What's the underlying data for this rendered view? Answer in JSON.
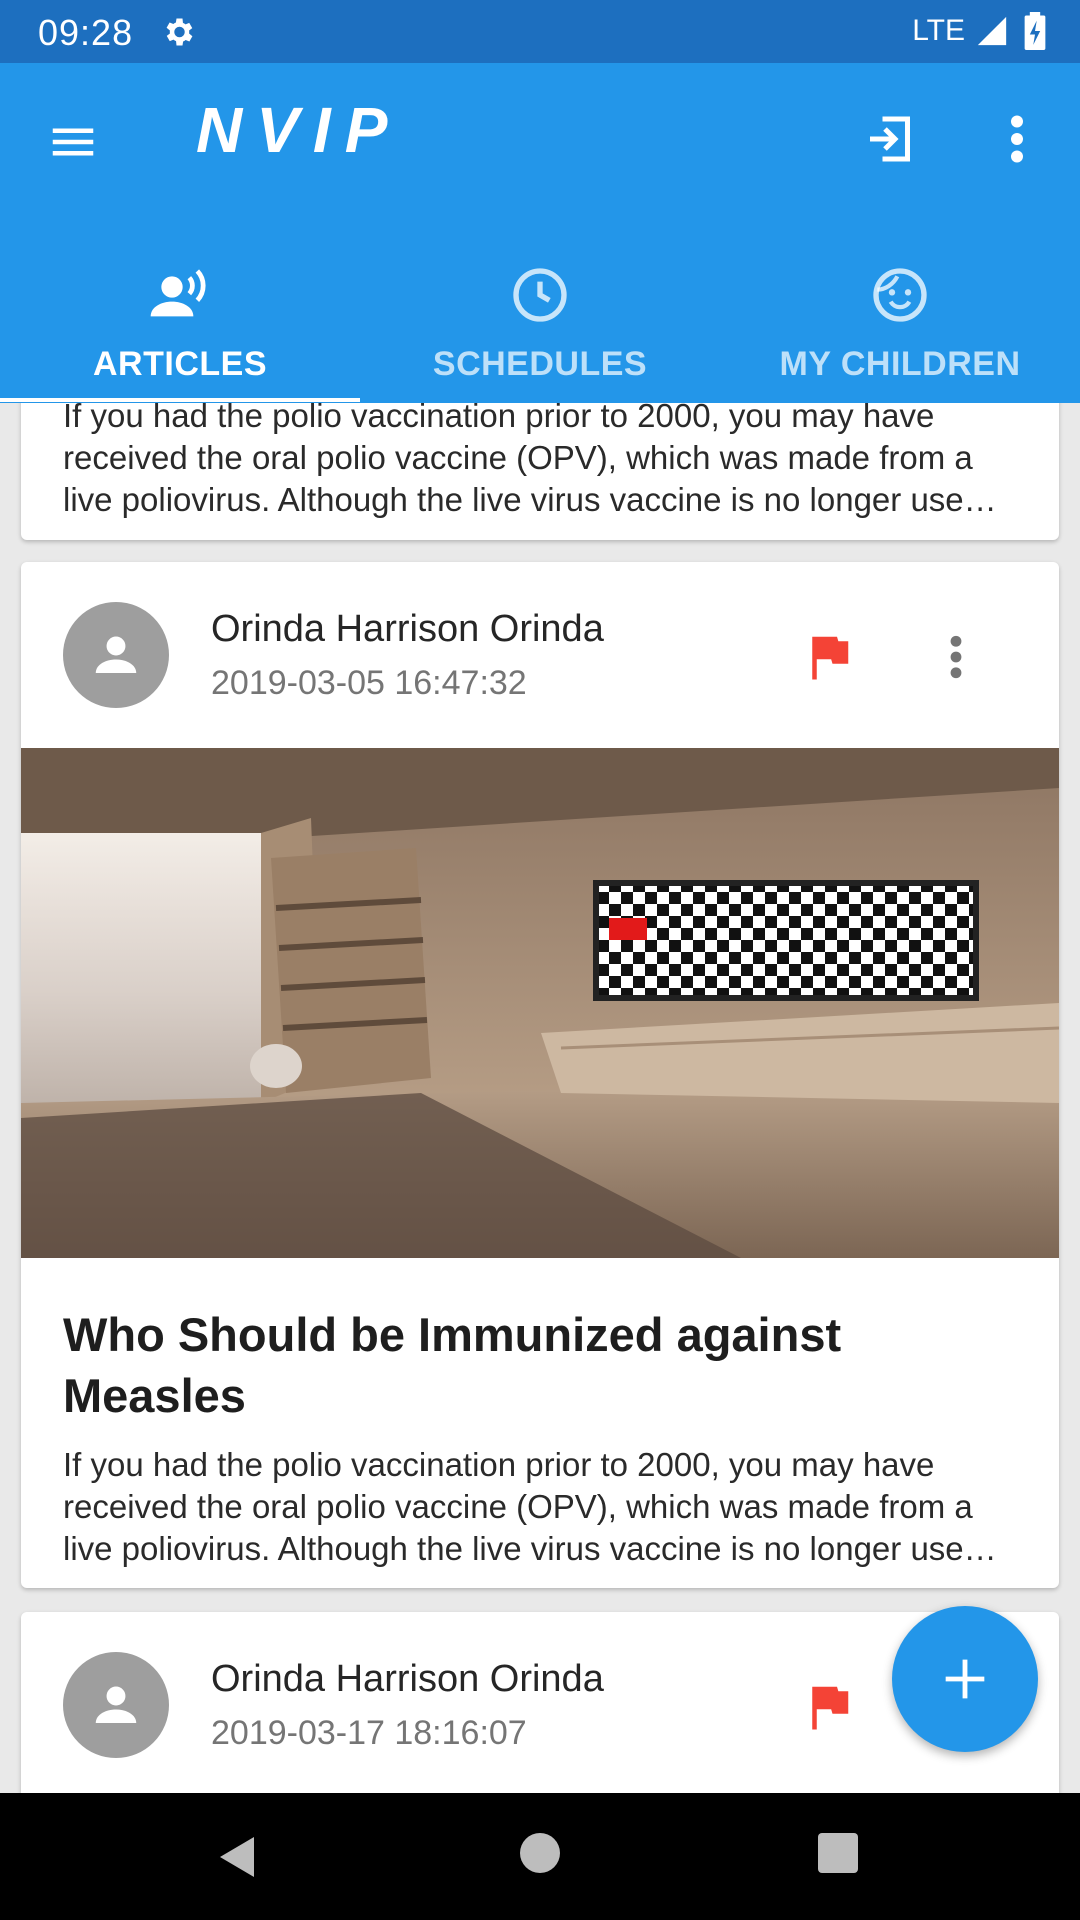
{
  "status_bar": {
    "time": "09:28",
    "network": "LTE"
  },
  "app_bar": {
    "title": "NVIP"
  },
  "tabs": [
    {
      "label": "ARTICLES",
      "icon": "speaker-person-icon",
      "selected": true
    },
    {
      "label": "SCHEDULES",
      "icon": "clock-icon",
      "selected": false
    },
    {
      "label": "MY CHILDREN",
      "icon": "child-face-icon",
      "selected": false
    }
  ],
  "articles": [
    {
      "excerpt": "If you had the polio vaccination prior to 2000, you may have received the oral polio vaccine (OPV), which was made from a live poliovirus. Although the live virus vaccine is no longer used in the United States"
    },
    {
      "author": "Orinda Harrison Orinda",
      "date": "2019-03-05 16:47:32",
      "title": "Who Should be Immunized against Measles",
      "excerpt": "If you had the polio vaccination prior to 2000, you may have received the oral polio vaccine (OPV), which was made from a live poliovirus. Although the live virus vaccine is no longer used in the United States"
    },
    {
      "author": "Orinda Harrison Orinda",
      "date": "2019-03-17 18:16:07"
    }
  ],
  "colors": {
    "primary": "#2396e9",
    "status_bar": "#1d6fbf",
    "flag": "#f44336"
  }
}
